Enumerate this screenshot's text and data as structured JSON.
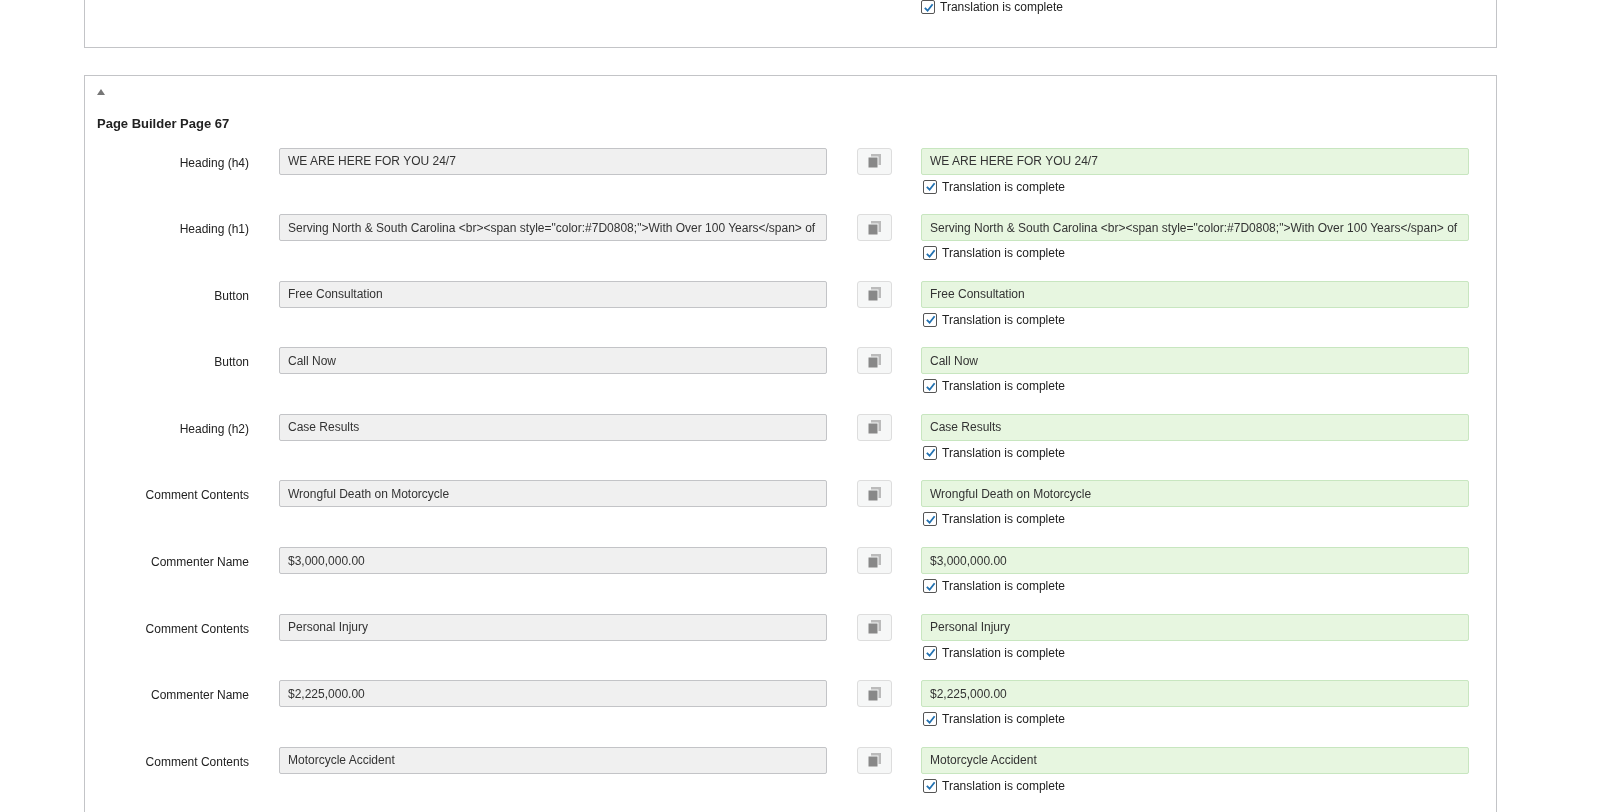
{
  "previous_section": {
    "complete": {
      "label": "Translation is complete",
      "checked": true
    }
  },
  "section": {
    "expanded": true,
    "title": "Page Builder Page 67",
    "rows": [
      {
        "label": "Heading (h4)",
        "source": "WE ARE HERE FOR YOU 24/7",
        "translation": "WE ARE HERE FOR YOU 24/7",
        "complete_label": "Translation is complete",
        "checked": true
      },
      {
        "label": "Heading (h1)",
        "source": "Serving North & South Carolina <br><span style=\"color:#7D0808;\">With Over 100 Years</span> of",
        "translation": "Serving North & South Carolina <br><span style=\"color:#7D0808;\">With Over 100 Years</span> of",
        "complete_label": "Translation is complete",
        "checked": true
      },
      {
        "label": "Button",
        "source": "Free Consultation",
        "translation": "Free Consultation",
        "complete_label": "Translation is complete",
        "checked": true
      },
      {
        "label": "Button",
        "source": "Call Now",
        "translation": "Call Now",
        "complete_label": "Translation is complete",
        "checked": true
      },
      {
        "label": "Heading (h2)",
        "source": "Case Results",
        "translation": "Case Results",
        "complete_label": "Translation is complete",
        "checked": true
      },
      {
        "label": "Comment Contents",
        "source": "Wrongful Death on Motorcycle",
        "translation": "Wrongful Death on Motorcycle",
        "complete_label": "Translation is complete",
        "checked": true
      },
      {
        "label": "Commenter Name",
        "source": "$3,000,000.00",
        "translation": "$3,000,000.00",
        "complete_label": "Translation is complete",
        "checked": true
      },
      {
        "label": "Comment Contents",
        "source": "Personal Injury",
        "translation": "Personal Injury",
        "complete_label": "Translation is complete",
        "checked": true
      },
      {
        "label": "Commenter Name",
        "source": "$2,225,000.00",
        "translation": "$2,225,000.00",
        "complete_label": "Translation is complete",
        "checked": true
      },
      {
        "label": "Comment Contents",
        "source": "Motorcycle Accident",
        "translation": "Motorcycle Accident",
        "complete_label": "Translation is complete",
        "checked": true
      }
    ]
  }
}
